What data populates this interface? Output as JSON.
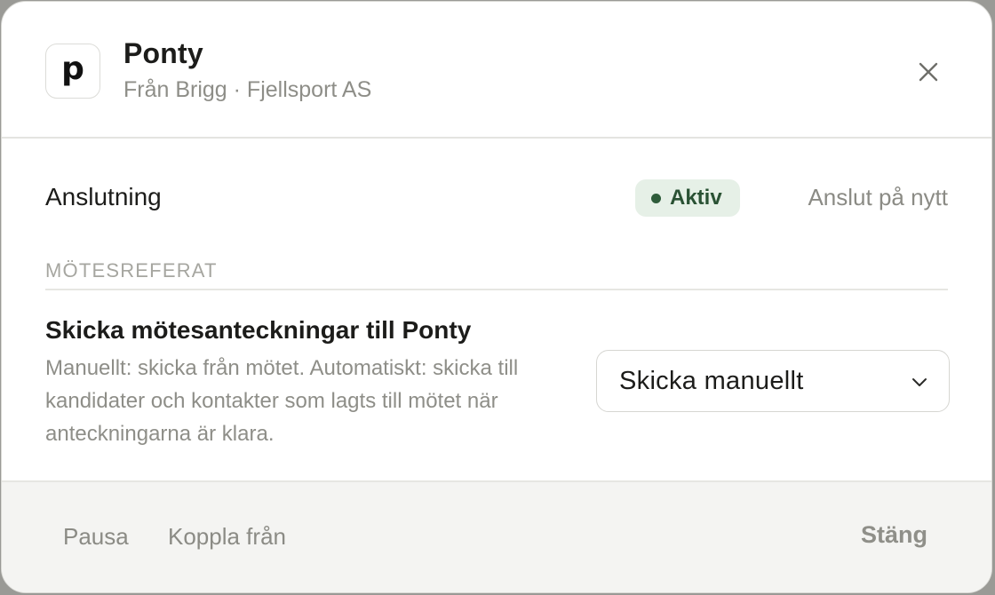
{
  "header": {
    "logo_letter": "p",
    "title": "Ponty",
    "subtitle": "Från Brigg · Fjellsport AS",
    "close_icon": "close-icon"
  },
  "connection": {
    "label": "Anslutning",
    "status": "Aktiv",
    "status_color": "#2e5c3a",
    "reconnect_label": "Anslut på nytt"
  },
  "meeting_notes": {
    "section_title": "MÖTESREFERAT",
    "setting_title": "Skicka mötesanteckningar till Ponty",
    "setting_description": "Manuellt: skicka från mötet. Automatiskt: skicka till kandidater och kontakter som lagts till mötet när anteckningarna är klara.",
    "select_value": "Skicka manuellt",
    "select_icon": "chevron-down-icon"
  },
  "footer": {
    "pause_label": "Pausa",
    "disconnect_label": "Koppla från",
    "close_label": "Stäng"
  }
}
